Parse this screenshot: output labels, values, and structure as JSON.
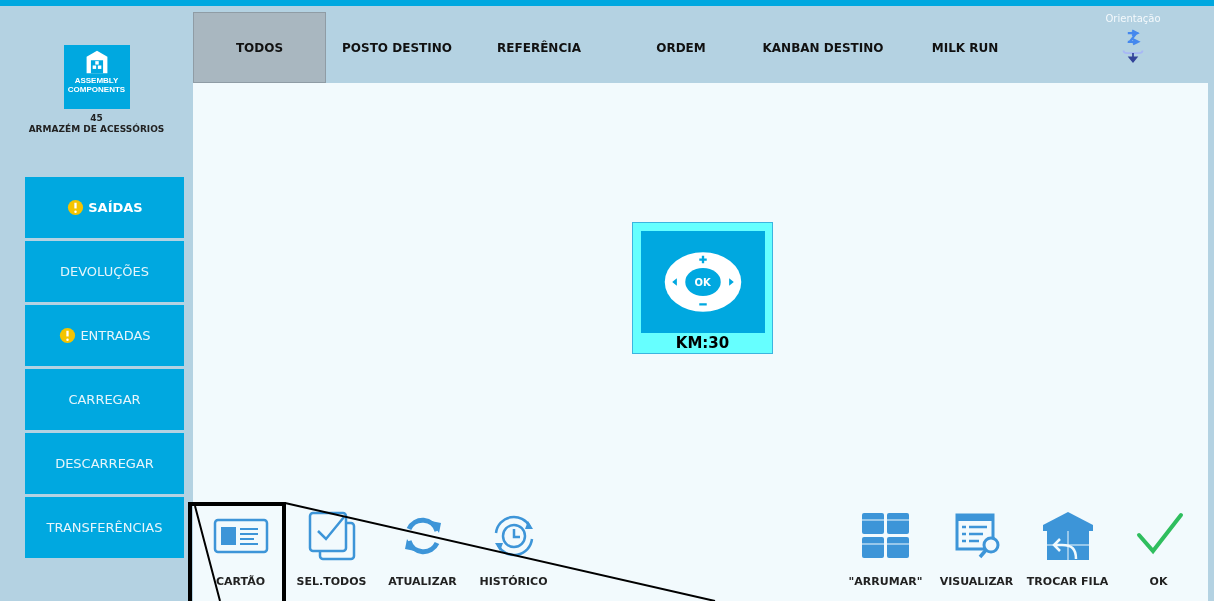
{
  "logo": {
    "brand": "ASSEMBLY COMPONENTS",
    "caption": "45",
    "subtitle": "ARMAZÉM DE ACESSÓRIOS"
  },
  "sidebar": {
    "items": [
      {
        "label": "SAÍDAS",
        "selected": true,
        "warning": true
      },
      {
        "label": "DEVOLUÇÕES",
        "selected": false,
        "warning": false
      },
      {
        "label": "ENTRADAS",
        "selected": false,
        "warning": true
      },
      {
        "label": "CARREGAR",
        "selected": false,
        "warning": false
      },
      {
        "label": "DESCARREGAR",
        "selected": false,
        "warning": false
      },
      {
        "label": "TRANSFERÊNCIAS",
        "selected": false,
        "warning": false
      }
    ]
  },
  "tabs": [
    {
      "label": "TODOS",
      "selected": true
    },
    {
      "label": "POSTO DESTINO",
      "selected": false
    },
    {
      "label": "REFERÊNCIA",
      "selected": false
    },
    {
      "label": "ORDEM",
      "selected": false
    },
    {
      "label": "KANBAN DESTINO",
      "selected": false
    },
    {
      "label": "MILK RUN",
      "selected": false
    }
  ],
  "orientation": {
    "label": "Orientação"
  },
  "cards": [
    {
      "label": "KM:30",
      "ok_label": "OK"
    }
  ],
  "toolbar_left": [
    {
      "label": "CARTÃO",
      "kind": "card"
    },
    {
      "label": "SEL.TODOS",
      "kind": "selectall"
    },
    {
      "label": "ATUALIZAR",
      "kind": "refresh"
    },
    {
      "label": "HISTÓRICO",
      "kind": "history"
    }
  ],
  "toolbar_right": [
    {
      "label": "\"ARRUMAR\"",
      "kind": "boxes"
    },
    {
      "label": "VISUALIZAR",
      "kind": "view"
    },
    {
      "label": "TROCAR FILA",
      "kind": "swap"
    },
    {
      "label": "OK",
      "kind": "ok"
    }
  ]
}
